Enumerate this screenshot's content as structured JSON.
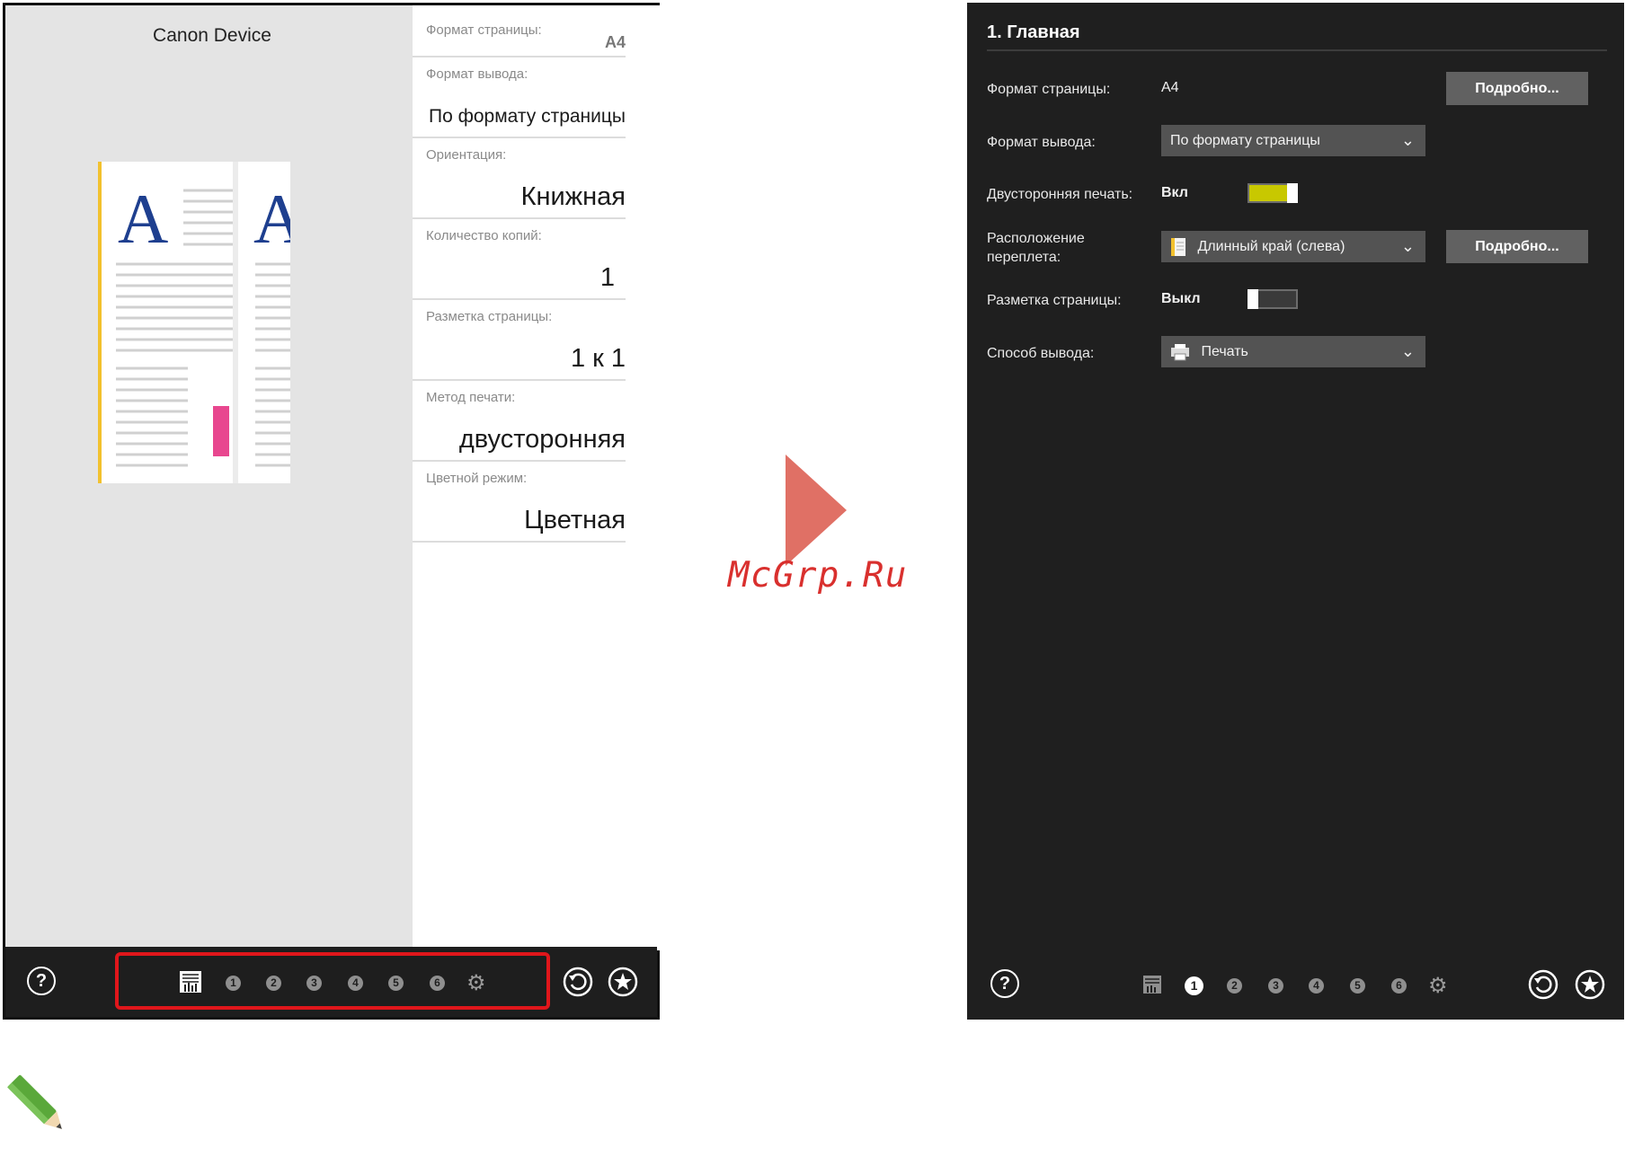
{
  "left": {
    "device_name": "Canon Device",
    "settings": [
      {
        "label": "Формат страницы:",
        "value": "A4"
      },
      {
        "label": "Формат вывода:",
        "value": "По формату страницы"
      },
      {
        "label": "Ориентация:",
        "value": "Книжная"
      },
      {
        "label": "Количество копий:",
        "value": "1"
      },
      {
        "label": "Разметка страницы:",
        "value": "1 к 1"
      },
      {
        "label": "Метод печати:",
        "value": "двусторонняя"
      },
      {
        "label": "Цветной режим:",
        "value": "Цветная"
      }
    ],
    "nav": [
      "1",
      "2",
      "3",
      "4",
      "5",
      "6"
    ],
    "help": "?",
    "highlight_color": "#e0161b"
  },
  "watermark": "McGrp.Ru",
  "right": {
    "title": "1. Главная",
    "rows": {
      "page_size": {
        "label": "Формат страницы:",
        "value": "A4",
        "button": "Подробно..."
      },
      "output_size": {
        "label": "Формат вывода:",
        "value": "По формату страницы"
      },
      "duplex": {
        "label": "Двусторонняя печать:",
        "state": "Вкл"
      },
      "binding": {
        "label_line1": "Расположение",
        "label_line2": "переплета:",
        "value": "Длинный край (слева)",
        "button": "Подробно..."
      },
      "layout": {
        "label": "Разметка страницы:",
        "state": "Выкл"
      },
      "output_method": {
        "label": "Способ вывода:",
        "value": "Печать"
      }
    },
    "nav": [
      "1",
      "2",
      "3",
      "4",
      "5",
      "6"
    ],
    "help": "?",
    "toggle_on_color": "#c8c800"
  }
}
